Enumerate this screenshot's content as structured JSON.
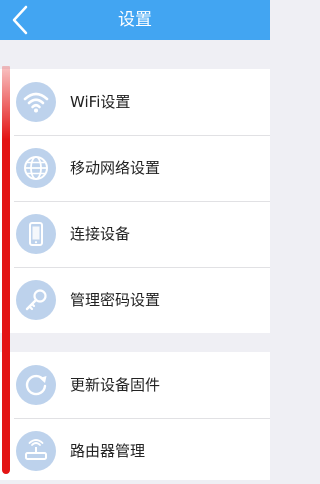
{
  "header": {
    "title": "设置",
    "back_icon": "chevron-left-icon"
  },
  "colors": {
    "header_bg": "#42a5f2",
    "icon_bg": "#bdd2ec",
    "annotation_bar": "#e31414"
  },
  "group1": {
    "items": [
      {
        "label": "WiFi设置",
        "icon": "wifi-icon"
      },
      {
        "label": "移动网络设置",
        "icon": "globe-icon"
      },
      {
        "label": "连接设备",
        "icon": "phone-icon"
      },
      {
        "label": "管理密码设置",
        "icon": "key-icon"
      }
    ]
  },
  "group2": {
    "items": [
      {
        "label": "更新设备固件",
        "icon": "refresh-icon"
      },
      {
        "label": "路由器管理",
        "icon": "router-icon"
      }
    ]
  }
}
